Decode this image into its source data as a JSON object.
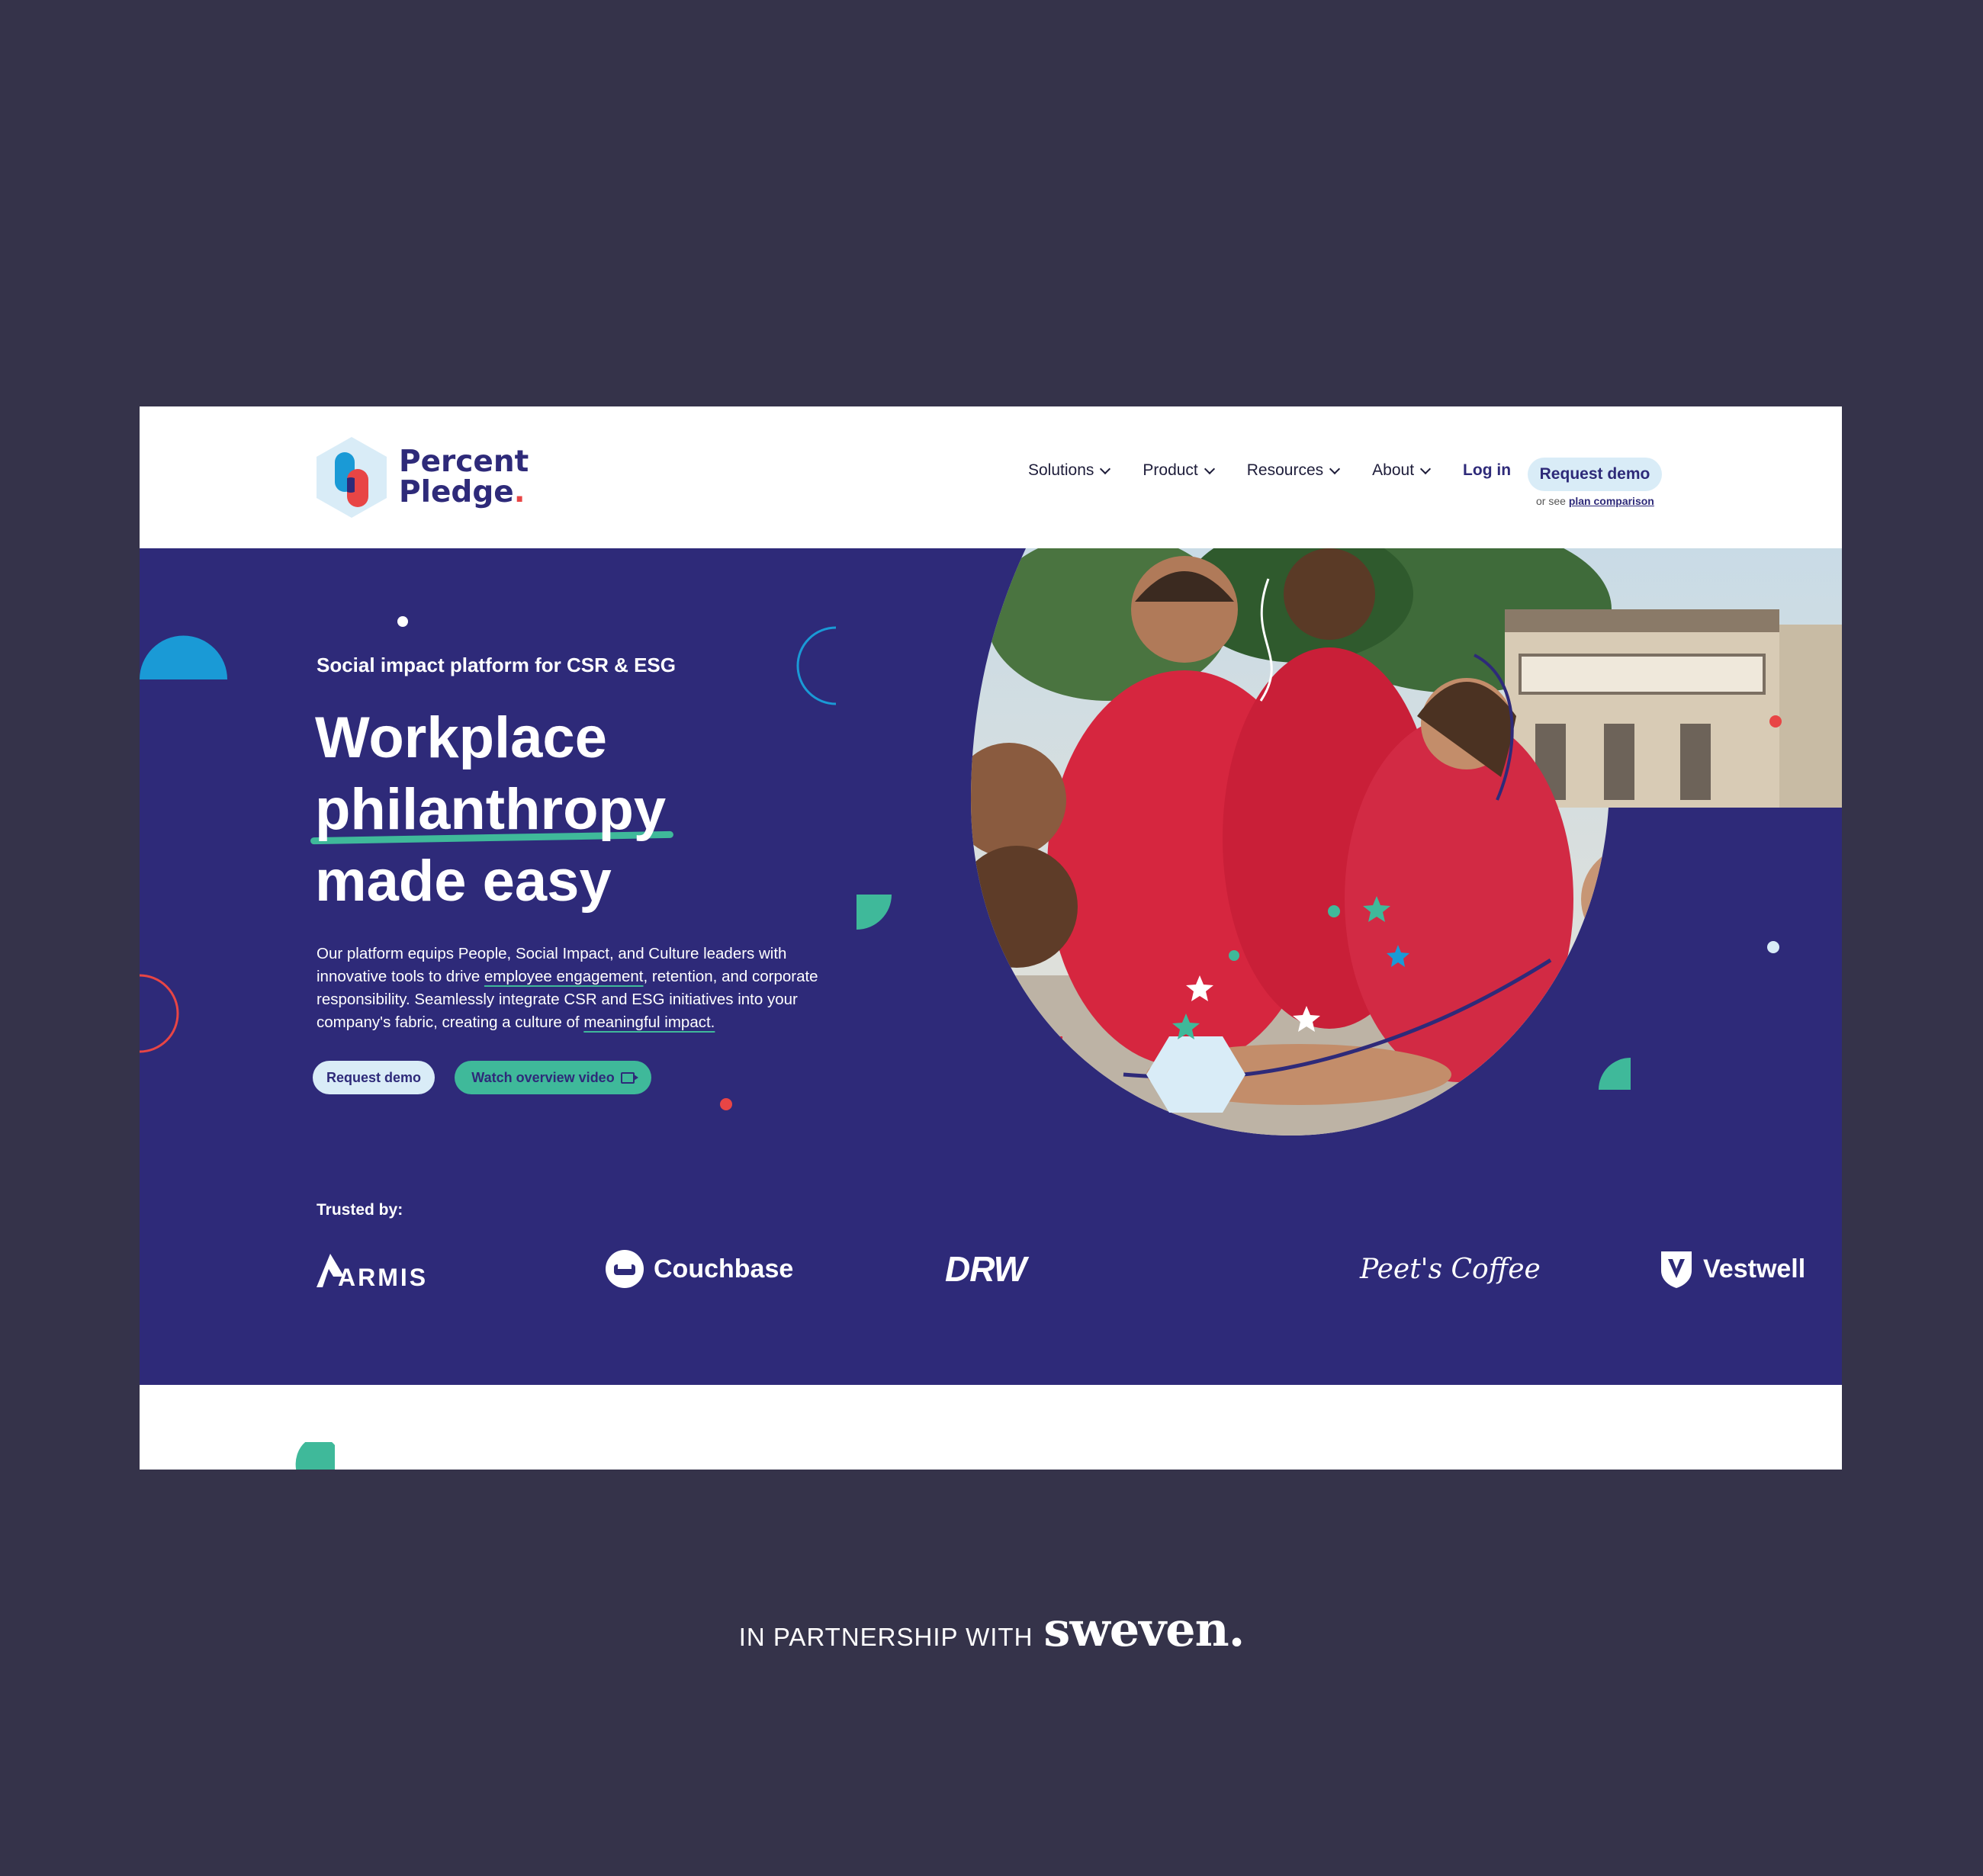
{
  "header": {
    "logo_line1": "Percent",
    "logo_line2": "Pledge",
    "logo_dot": ".",
    "nav": [
      {
        "label": "Solutions"
      },
      {
        "label": "Product"
      },
      {
        "label": "Resources"
      },
      {
        "label": "About"
      }
    ],
    "login_label": "Log in",
    "request_demo_label": "Request demo",
    "plan_note_prefix": "or see",
    "plan_note_link": "plan comparison"
  },
  "hero": {
    "eyebrow": "Social impact platform for CSR & ESG",
    "headline_line1": "Workplace",
    "headline_line2": "philanthropy",
    "headline_line3": "made easy",
    "desc_part1": "Our platform equips People, Social Impact, and Culture leaders with innovative tools to drive ",
    "desc_link1": "employee engagement",
    "desc_part2": ", retention, and corporate responsibility. Seamlessly integrate CSR and ESG initiatives into your company's fabric, creating a culture of ",
    "desc_link2": "meaningful impact.",
    "btn_demo": "Request demo",
    "btn_video": "Watch overview video",
    "trusted_label": "Trusted by:",
    "brands": [
      "ARMIS",
      "Couchbase",
      "DRW",
      "Peet's Coffee",
      "Vestwell"
    ]
  },
  "credit": {
    "text": "IN PARTNERSHIP WITH",
    "brand": "sweven",
    "brand_dot": "."
  },
  "colors": {
    "page_bg": "#35334a",
    "hero_bg": "#2e2a79",
    "accent_green": "#3fb99a",
    "accent_blue": "#1a9ad6",
    "accent_red": "#e84545",
    "light_blue": "#d9ecf7"
  }
}
